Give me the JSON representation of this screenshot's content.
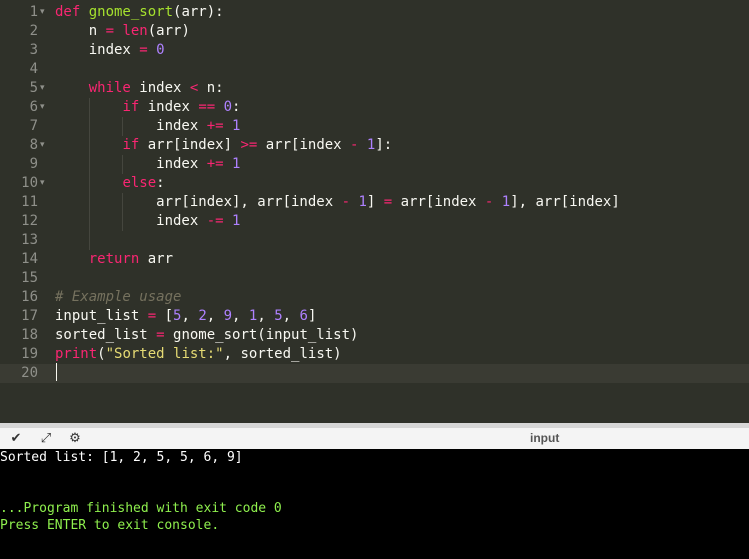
{
  "editor": {
    "language": "python",
    "line_numbers": [
      "1",
      "2",
      "3",
      "4",
      "5",
      "6",
      "7",
      "8",
      "9",
      "10",
      "11",
      "12",
      "13",
      "14",
      "15",
      "16",
      "17",
      "18",
      "19",
      "20"
    ],
    "foldable_lines": [
      1,
      5,
      6,
      8,
      10
    ],
    "active_line": 20,
    "code_lines": [
      [
        [
          "kw",
          "def "
        ],
        [
          "fn",
          "gnome_sort"
        ],
        [
          "ident",
          "(arr):"
        ]
      ],
      [
        [
          "ident",
          "    n "
        ],
        [
          "kw",
          "="
        ],
        [
          "ident",
          " "
        ],
        [
          "kw",
          "len"
        ],
        [
          "ident",
          "(arr)"
        ]
      ],
      [
        [
          "ident",
          "    index "
        ],
        [
          "kw",
          "="
        ],
        [
          "ident",
          " "
        ],
        [
          "num",
          "0"
        ]
      ],
      [],
      [
        [
          "ident",
          "    "
        ],
        [
          "kw",
          "while"
        ],
        [
          "ident",
          " index "
        ],
        [
          "kw",
          "<"
        ],
        [
          "ident",
          " n:"
        ]
      ],
      [
        [
          "ident",
          "        "
        ],
        [
          "kw",
          "if"
        ],
        [
          "ident",
          " index "
        ],
        [
          "kw",
          "=="
        ],
        [
          "ident",
          " "
        ],
        [
          "num",
          "0"
        ],
        [
          "ident",
          ":"
        ]
      ],
      [
        [
          "ident",
          "            index "
        ],
        [
          "kw",
          "+="
        ],
        [
          "ident",
          " "
        ],
        [
          "num",
          "1"
        ]
      ],
      [
        [
          "ident",
          "        "
        ],
        [
          "kw",
          "if"
        ],
        [
          "ident",
          " arr[index] "
        ],
        [
          "kw",
          ">="
        ],
        [
          "ident",
          " arr[index "
        ],
        [
          "kw",
          "-"
        ],
        [
          "ident",
          " "
        ],
        [
          "num",
          "1"
        ],
        [
          "ident",
          "]:"
        ]
      ],
      [
        [
          "ident",
          "            index "
        ],
        [
          "kw",
          "+="
        ],
        [
          "ident",
          " "
        ],
        [
          "num",
          "1"
        ]
      ],
      [
        [
          "ident",
          "        "
        ],
        [
          "kw",
          "else"
        ],
        [
          "ident",
          ":"
        ]
      ],
      [
        [
          "ident",
          "            arr[index], arr[index "
        ],
        [
          "kw",
          "-"
        ],
        [
          "ident",
          " "
        ],
        [
          "num",
          "1"
        ],
        [
          "ident",
          "] "
        ],
        [
          "kw",
          "="
        ],
        [
          "ident",
          " arr[index "
        ],
        [
          "kw",
          "-"
        ],
        [
          "ident",
          " "
        ],
        [
          "num",
          "1"
        ],
        [
          "ident",
          "], arr[index]"
        ]
      ],
      [
        [
          "ident",
          "            index "
        ],
        [
          "kw",
          "-="
        ],
        [
          "ident",
          " "
        ],
        [
          "num",
          "1"
        ]
      ],
      [],
      [
        [
          "ident",
          "    "
        ],
        [
          "kw",
          "return"
        ],
        [
          "ident",
          " arr"
        ]
      ],
      [],
      [
        [
          "cmt",
          "# Example usage"
        ]
      ],
      [
        [
          "ident",
          "input_list "
        ],
        [
          "kw",
          "="
        ],
        [
          "ident",
          " ["
        ],
        [
          "num",
          "5"
        ],
        [
          "ident",
          ", "
        ],
        [
          "num",
          "2"
        ],
        [
          "ident",
          ", "
        ],
        [
          "num",
          "9"
        ],
        [
          "ident",
          ", "
        ],
        [
          "num",
          "1"
        ],
        [
          "ident",
          ", "
        ],
        [
          "num",
          "5"
        ],
        [
          "ident",
          ", "
        ],
        [
          "num",
          "6"
        ],
        [
          "ident",
          "]"
        ]
      ],
      [
        [
          "ident",
          "sorted_list "
        ],
        [
          "kw",
          "="
        ],
        [
          "ident",
          " gnome_sort(input_list)"
        ]
      ],
      [
        [
          "kw",
          "print"
        ],
        [
          "ident",
          "("
        ],
        [
          "str",
          "\"Sorted list:\""
        ],
        [
          "ident",
          ", sorted_list)"
        ]
      ],
      []
    ]
  },
  "toolbar": {
    "collapse_icon": "chevron-down-icon",
    "expand_icon": "expand-arrows-icon",
    "settings_icon": "terminal-settings-icon",
    "input_label": "input"
  },
  "console": {
    "output_line": "Sorted list: [1, 2, 5, 5, 6, 9]",
    "finish_line": "...Program finished with exit code 0",
    "prompt_line": "Press ENTER to exit console."
  },
  "colors": {
    "editor_bg": "#2f3129",
    "keyword": "#f92672",
    "function": "#a6e22e",
    "number": "#ae81ff",
    "string": "#e6db74",
    "comment": "#75715e",
    "console_green": "#8ff04e"
  }
}
